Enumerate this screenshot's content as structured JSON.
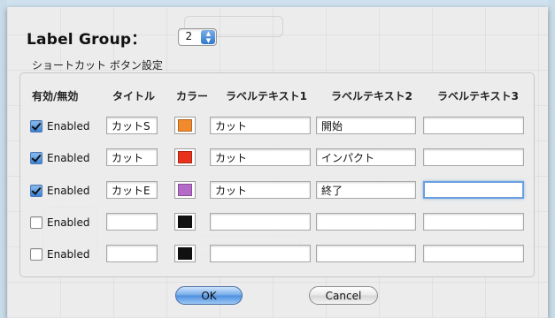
{
  "dialog": {
    "title_label": "Label Group：",
    "group_value": "2"
  },
  "section": {
    "title": "ショートカット ボタン設定"
  },
  "headers": {
    "enabled": "有効/無効",
    "title": "タイトル",
    "color": "カラー",
    "label1": "ラベルテキスト1",
    "label2": "ラベルテキスト2",
    "label3": "ラベルテキスト3"
  },
  "rows": [
    {
      "checked": true,
      "enabled_label": "Enabled",
      "title": "カットS",
      "color": "#f08a2c",
      "label1": "カット",
      "label2": "開始",
      "label3": ""
    },
    {
      "checked": true,
      "enabled_label": "Enabled",
      "title": "カット",
      "color": "#e8321c",
      "label1": "カット",
      "label2": "インパクト",
      "label3": ""
    },
    {
      "checked": true,
      "enabled_label": "Enabled",
      "title": "カットE",
      "color": "#b46ac8",
      "label1": "カット",
      "label2": "終了",
      "label3": ""
    },
    {
      "checked": false,
      "enabled_label": "Enabled",
      "title": "",
      "color": "#111111",
      "label1": "",
      "label2": "",
      "label3": ""
    },
    {
      "checked": false,
      "enabled_label": "Enabled",
      "title": "",
      "color": "#111111",
      "label1": "",
      "label2": "",
      "label3": ""
    }
  ],
  "buttons": {
    "ok": "OK",
    "cancel": "Cancel"
  }
}
